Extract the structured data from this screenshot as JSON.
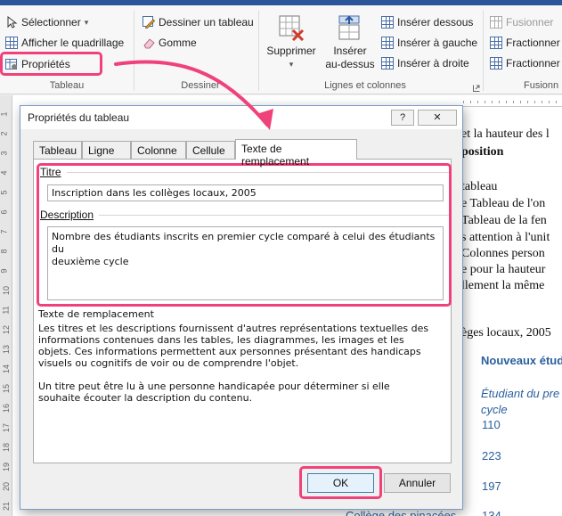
{
  "ribbon": {
    "table_group": {
      "select_label": "Sélectionner",
      "select_caret": "▾",
      "gridlines_label": "Afficher le quadrillage",
      "properties_label": "Propriétés",
      "group_label": "Tableau"
    },
    "draw_group": {
      "draw_table_label": "Dessiner un tableau",
      "eraser_label": "Gomme",
      "group_label": "Dessiner"
    },
    "rows_cols_group": {
      "delete_label": "Supprimer",
      "delete_caret": "▾",
      "insert_above_label_1": "Insérer",
      "insert_above_label_2": "au-dessus",
      "insert_below_label": "Insérer dessous",
      "insert_left_label": "Insérer à gauche",
      "insert_right_label": "Insérer à droite",
      "group_label": "Lignes et colonnes",
      "launcher_icon": "dialog-launcher-icon"
    },
    "merge_group": {
      "merge_label": "Fusionner",
      "split_label": "Fractionner",
      "split_table_label": "Fractionner",
      "group_label": "Fusionn"
    }
  },
  "document": {
    "lines": [
      "et la hauteur des l",
      "position",
      "",
      "tableau",
      "e Tableau de l'on",
      "Tableau de la fen",
      "s attention à l'unit",
      "Colonnes person",
      "e pour la hauteur",
      "llement la même",
      "",
      "èges locaux, 2005"
    ],
    "table_header": "Nouveaux étud",
    "table_sub_1": "Étudiant du pre",
    "table_sub_2": "cycle",
    "values": [
      "110",
      "223",
      "197",
      "134"
    ],
    "bottom_row": "Collège des pinacées",
    "ruler_numbers": [
      "1",
      "2",
      "3",
      "4",
      "5",
      "6",
      "7",
      "8",
      "9",
      "10",
      "11",
      "12",
      "13",
      "14",
      "15",
      "16",
      "17",
      "18",
      "19",
      "20",
      "21"
    ]
  },
  "dialog": {
    "title": "Propriétés du tableau",
    "help_btn": "?",
    "close_btn": "✕",
    "tabs": [
      "Tableau",
      "Ligne",
      "Colonne",
      "Cellule",
      "Texte de remplacement"
    ],
    "active_tab": "Texte de remplacement",
    "titre_label": "Titre",
    "titre_value": "Inscription dans les collèges locaux, 2005",
    "description_label": "Description",
    "description_value": "Nombre des étudiants inscrits en premier cycle comparé à celui des étudiants du\ndeuxième cycle",
    "help_heading": "Texte de remplacement",
    "help_p1": "Les titres et les descriptions fournissent d'autres représentations textuelles des informations contenues dans les tables, les diagrammes, les images et les objets. Ces informations permettent aux personnes présentant des handicaps visuels ou cognitifs de voir ou de comprendre l'objet.",
    "help_p2": "Un titre peut être lu à une personne handicapée pour déterminer si elle souhaite écouter la description du contenu.",
    "ok_label": "OK",
    "cancel_label": "Annuler"
  },
  "colors": {
    "highlight": "#f0427a",
    "word_blue": "#2b579a",
    "link_blue": "#2a5f9e"
  }
}
